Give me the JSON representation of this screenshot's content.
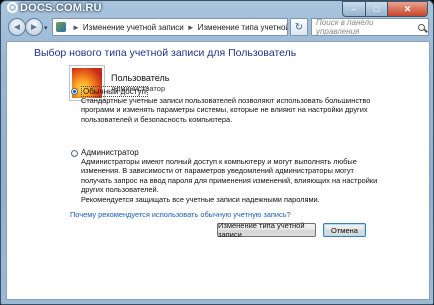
{
  "watermark": "DOCS.COM.RU",
  "titlebar": {
    "min": "–",
    "max": "□",
    "close": "✕"
  },
  "nav": {
    "back_icon": "◄",
    "forward_icon": "►",
    "dropdown_icon": "▾",
    "breadcrumb": [
      "Изменение учетной записи",
      "Изменение типа учетной записи"
    ],
    "breadcrumb_sep": "►",
    "refresh_icon": "↻",
    "search_placeholder": "Поиск в панели управления"
  },
  "page": {
    "title": "Выбор нового типа учетной записи для Пользователь",
    "user": {
      "name": "Пользователь",
      "role": "Администратор"
    },
    "options": [
      {
        "label": "Обычный доступ",
        "selected": true,
        "description": "Стандартные учетные записи пользователей позволяют использовать большинство программ и изменять параметры системы, которые не влияют на настройки других пользователей и безопасность компьютера."
      },
      {
        "label": "Администратор",
        "selected": false,
        "description": "Администраторы имеют полный доступ к компьютеру и могут выполнять любые изменения. В зависимости от параметров уведомлений администраторы могут получать запрос на ввод пароля для применения изменений, влияющих на настройки других пользователей."
      }
    ],
    "recommendation": "Рекомендуется защищать все учетные записи надежными паролями.",
    "link": "Почему рекомендуется использовать обычную учетную запись?",
    "buttons": {
      "change": "Изменение типа учетной записи",
      "cancel": "Отмена"
    }
  }
}
